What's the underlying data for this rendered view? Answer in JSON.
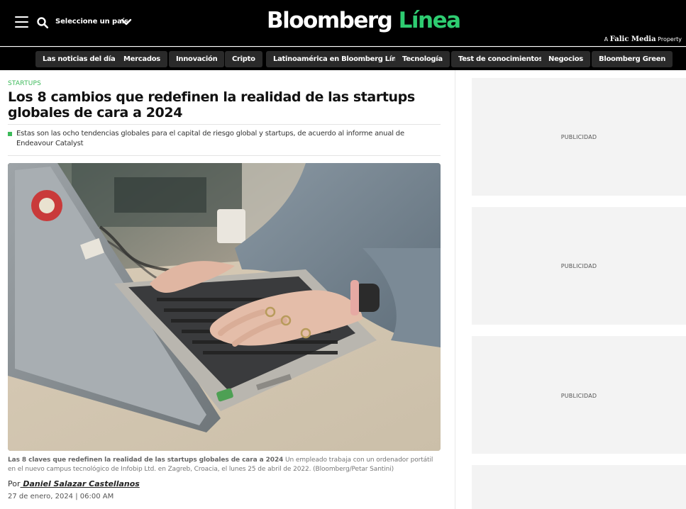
{
  "header": {
    "country_selector": "Seleccione un país",
    "logo_main": "Bloomberg",
    "logo_accent": "Línea",
    "property_prefix": "A",
    "property_brand": "Falic Media",
    "property_suffix": "Property"
  },
  "nav": {
    "items": [
      "Las noticias del día",
      "Mercados",
      "Innovación",
      "Cripto",
      "Latinoamérica en Bloomberg Línea",
      "Tecnología",
      "Test de conocimientos",
      "Negocios",
      "Bloomberg Green"
    ]
  },
  "article": {
    "category": "STARTUPS",
    "headline": "Los 8 cambios que redefinen la realidad de las startups globales de cara a 2024",
    "summary": "Estas son las ocho tendencias globales para el capital de riesgo global y startups, de acuerdo al informe anual de Endeavour Catalyst",
    "caption_bold": "Las 8 claves que redefinen la realidad de las startups globales de cara a 2024",
    "caption_text": " Un empleado trabaja con un ordenador portátil en el nuevo campus tecnológico de Infobip Ltd. en Zagreb, Croacia, el lunes 25 de abril de 2022. (Bloomberg/Petar Santini)",
    "byline_prefix": "Por",
    "author": " Daniel Salazar Castellanos",
    "date": "27 de enero, 2024 | 06:00 AM"
  },
  "sidebar": {
    "ads": [
      "PUBLICIDAD",
      "PUBLICIDAD",
      "PUBLICIDAD"
    ]
  },
  "colors": {
    "brand_green": "#2ecc71",
    "category_green": "#3cba5a",
    "header_bg": "#000000",
    "nav_pill_bg": "#2a2a2a",
    "ad_bg": "#f3f3f3"
  },
  "icons": [
    "hamburger-icon",
    "search-icon",
    "chevron-down-icon"
  ]
}
